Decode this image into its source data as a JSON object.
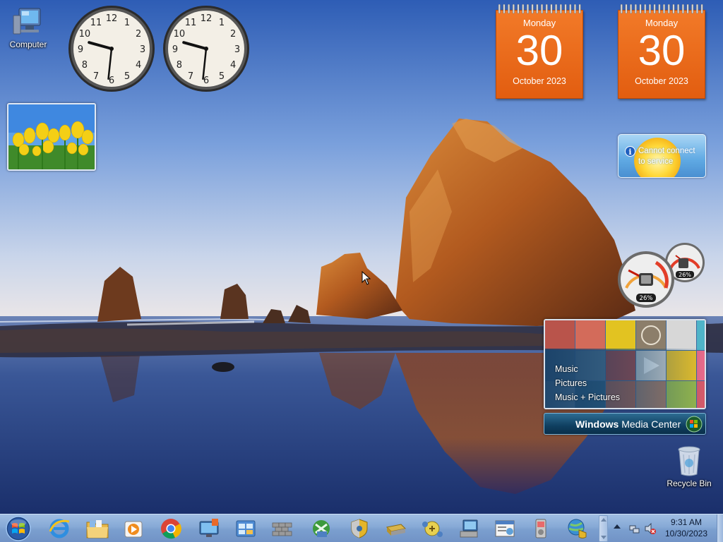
{
  "desktop": {
    "icons": [
      {
        "label": "Computer",
        "icon": "computer-icon"
      },
      {
        "label": "Recycle Bin",
        "icon": "recycle-bin-icon"
      }
    ]
  },
  "clocks": [
    {
      "time": "9:31",
      "hour": 9,
      "minute": 31
    },
    {
      "time": "9:31",
      "hour": 9,
      "minute": 31
    }
  ],
  "clock_numbers": [
    "12",
    "1",
    "2",
    "3",
    "4",
    "5",
    "6",
    "7",
    "8",
    "9",
    "10",
    "11"
  ],
  "calendars": [
    {
      "day": "Monday",
      "date": "30",
      "month": "October 2023"
    },
    {
      "day": "Monday",
      "date": "30",
      "month": "October 2023"
    }
  ],
  "weather": {
    "message": "Cannot connect to service",
    "info_icon": "info-icon"
  },
  "cpu_meter": {
    "cpu_percent": "26%",
    "memory_percent": "26%",
    "cpu_value": 26,
    "memory_value": 26
  },
  "media_center": {
    "items": [
      "Music",
      "Pictures",
      "Music + Pictures"
    ],
    "brand_bold": "Windows",
    "brand_light": "Media Center"
  },
  "taskbar": {
    "start_icon": "windows-start-orb",
    "pinned": [
      "internet-explorer-icon",
      "file-explorer-icon",
      "media-player-icon",
      "chrome-icon",
      "remote-desktop-icon",
      "control-panel-icon",
      "firewall-icon",
      "network-sharing-icon",
      "security-shield-icon",
      "storage-drive-icon",
      "connectivity-icon",
      "computer-monitor-icon",
      "admin-tools-icon",
      "device-icon",
      "network-globe-icon"
    ],
    "clock": {
      "time": "9:31 AM",
      "date": "10/30/2023"
    }
  },
  "colors": {
    "calendar_orange": "#e8651a",
    "taskbar_blue": "#86a9d6",
    "weather_blue": "#5fa9e3"
  }
}
